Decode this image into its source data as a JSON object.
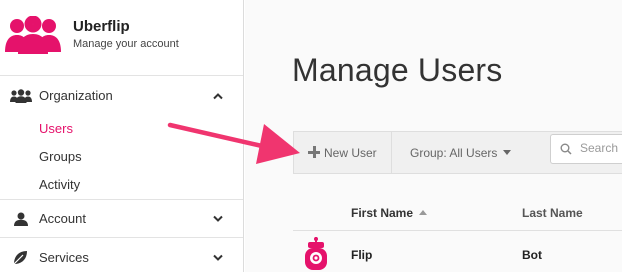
{
  "brand": {
    "title": "Uberflip",
    "subtitle": "Manage your account",
    "accent": "#e5126b"
  },
  "sidebar": {
    "organization": {
      "label": "Organization",
      "icon": "users-group-icon",
      "expanded": true
    },
    "items": [
      {
        "label": "Users",
        "active": true
      },
      {
        "label": "Groups",
        "active": false
      },
      {
        "label": "Activity",
        "active": false
      }
    ],
    "account": {
      "label": "Account",
      "icon": "user-icon"
    },
    "services": {
      "label": "Services",
      "icon": "leaf-icon"
    }
  },
  "main": {
    "title": "Manage Users",
    "toolbar": {
      "new_user_label": "New User",
      "group_filter_label": "Group: All Users",
      "search_placeholder": "Search"
    },
    "table": {
      "columns": [
        "First Name",
        "Last Name"
      ],
      "sorted_by": "First Name",
      "rows": [
        {
          "first_name": "Flip",
          "last_name": "Bot"
        }
      ]
    }
  },
  "annotation": {
    "color": "#f0356f",
    "shape": "arrow"
  }
}
